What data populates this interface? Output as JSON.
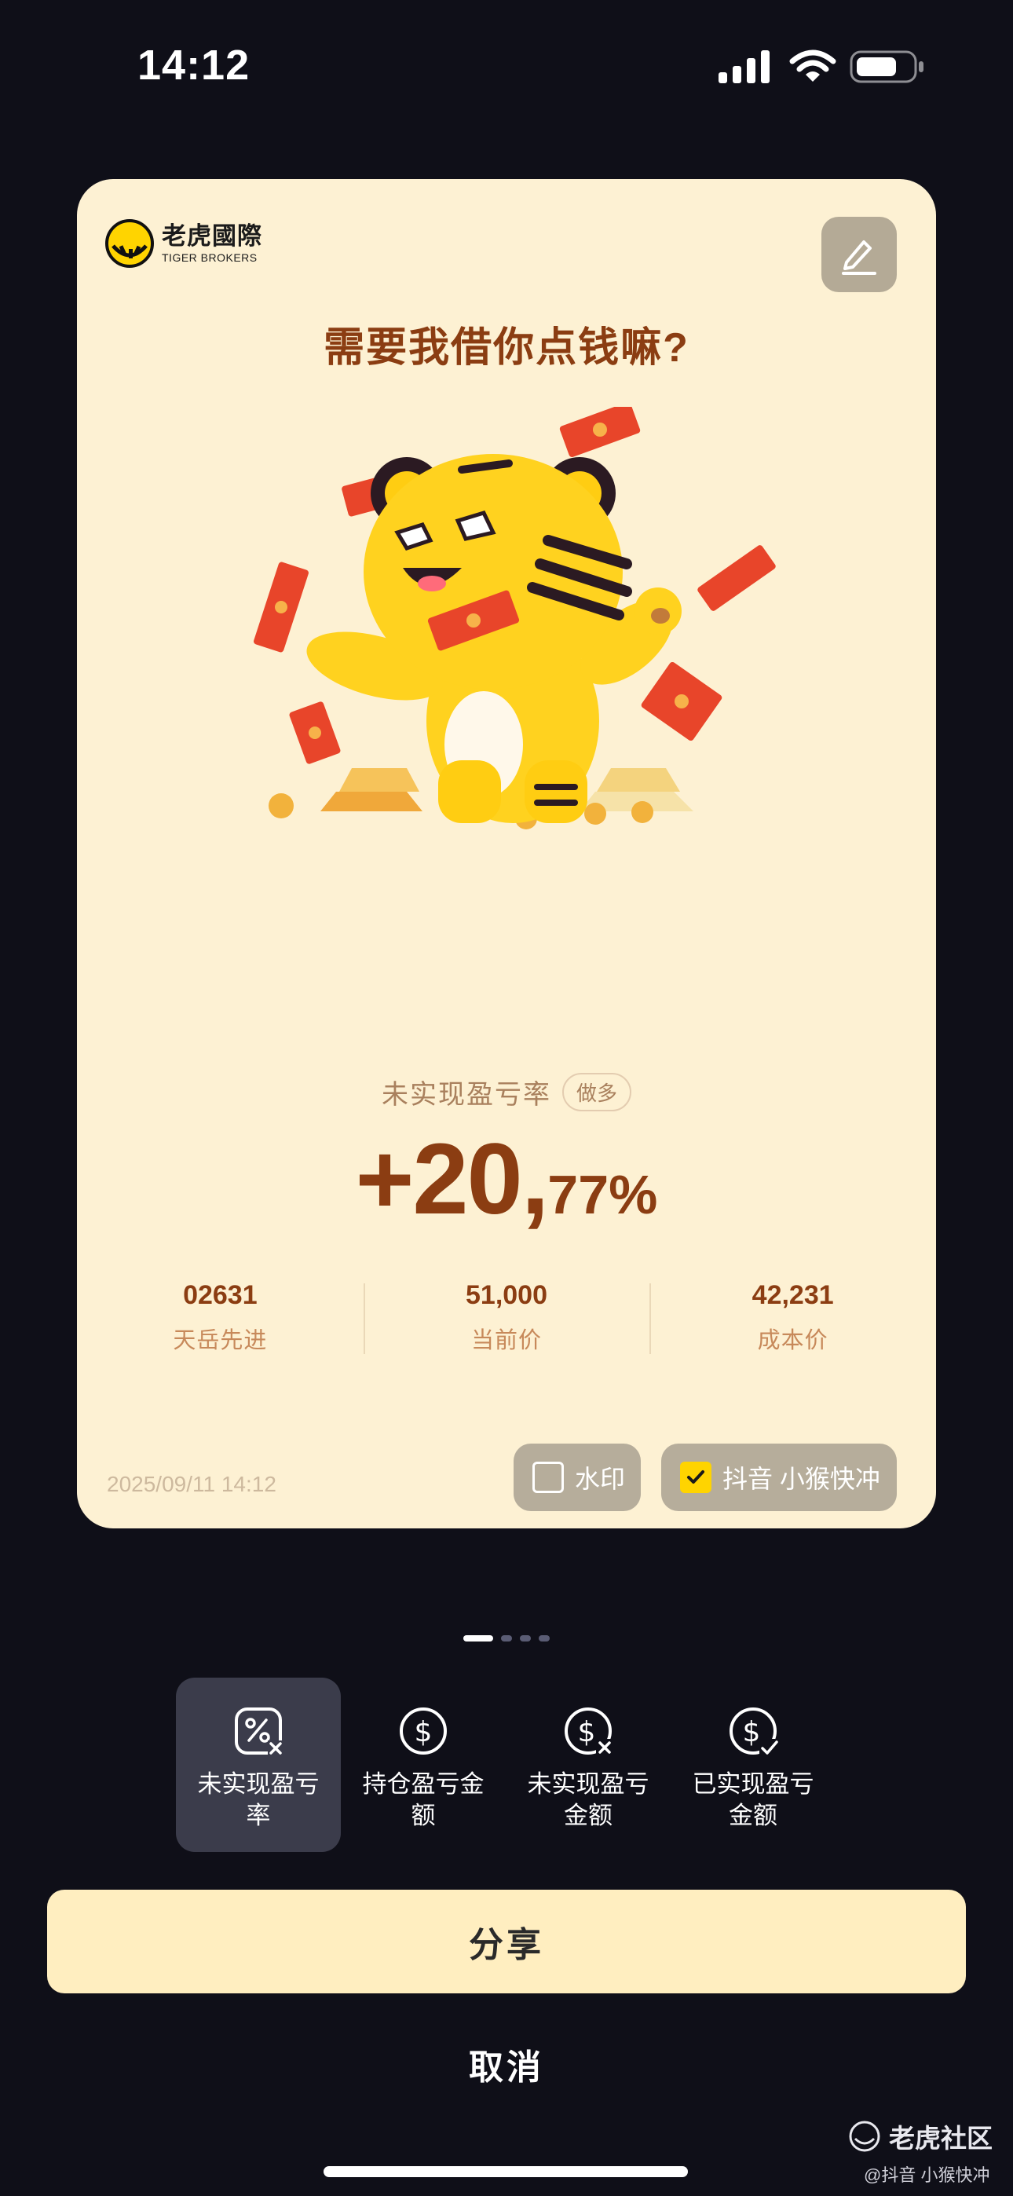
{
  "status_bar": {
    "time": "14:12"
  },
  "card": {
    "brand": {
      "name_cn": "老虎國際",
      "name_en": "TIGER BROKERS"
    },
    "title": "需要我借你点钱嘛?",
    "metric": {
      "label": "未实现盈亏率",
      "position_badge": "做多",
      "value_main": "+20,",
      "value_sub": "77%"
    },
    "stats": [
      {
        "value": "02631",
        "label": "天岳先进"
      },
      {
        "value": "51,000",
        "label": "当前价"
      },
      {
        "value": "42,231",
        "label": "成本价"
      }
    ],
    "timestamp": "2025/09/11 14:12",
    "toggles": {
      "watermark": {
        "label": "水印",
        "checked": false
      },
      "account": {
        "label": "抖音 小猴快冲",
        "checked": true
      }
    }
  },
  "pager": {
    "count": 4,
    "active": 0
  },
  "tabs": [
    {
      "label": "未实现盈亏率",
      "icon": "percent-x-icon",
      "active": true
    },
    {
      "label": "持仓盈亏金额",
      "icon": "dollar-icon",
      "active": false
    },
    {
      "label": "未实现盈亏金额",
      "icon": "dollar-x-icon",
      "active": false
    },
    {
      "label": "已实现盈亏金额",
      "icon": "dollar-check-icon",
      "active": false
    }
  ],
  "actions": {
    "share_label": "分享",
    "cancel_label": "取消"
  },
  "watermark": {
    "forum_name": "老虎社区",
    "handle": "@抖音 小猴快冲"
  },
  "colors": {
    "card_bg": "#fdf1d3",
    "accent_brown": "#8b3d12",
    "share_bg": "#ffeec0",
    "page_bg": "#0f0f18",
    "checkbox_on": "#ffd400"
  }
}
